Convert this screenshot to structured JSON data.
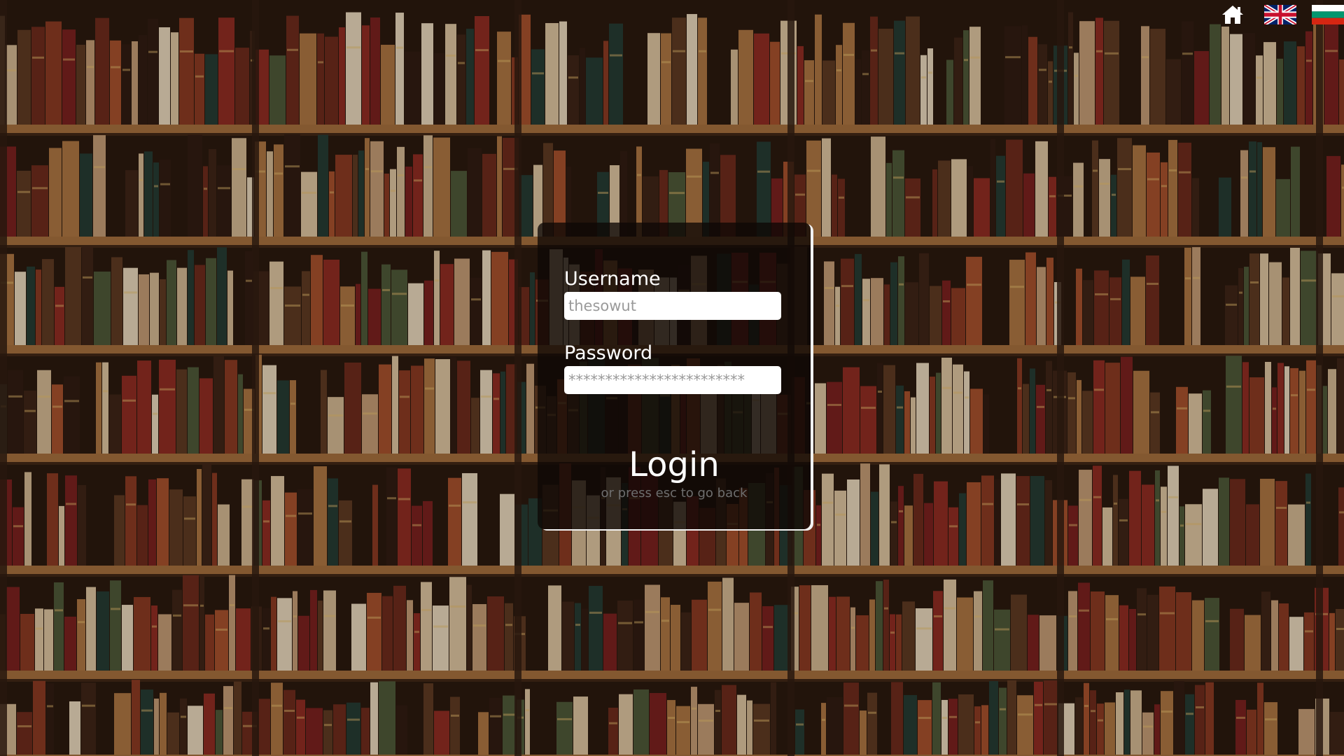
{
  "background": {
    "description_icon": "bookshelf-background",
    "colors": {
      "wood": "#8a5a2e",
      "dark": "#1e130b"
    }
  },
  "topbar": {
    "home_icon": "home-icon",
    "lang_en_icon": "uk-flag-icon",
    "lang_bg_icon": "bulgaria-flag-icon"
  },
  "login": {
    "username_label": "Username",
    "username_value": "thesowut",
    "password_label": "Password",
    "password_value": "************************",
    "submit_label": "Login",
    "hint": "or press esc to go back"
  }
}
